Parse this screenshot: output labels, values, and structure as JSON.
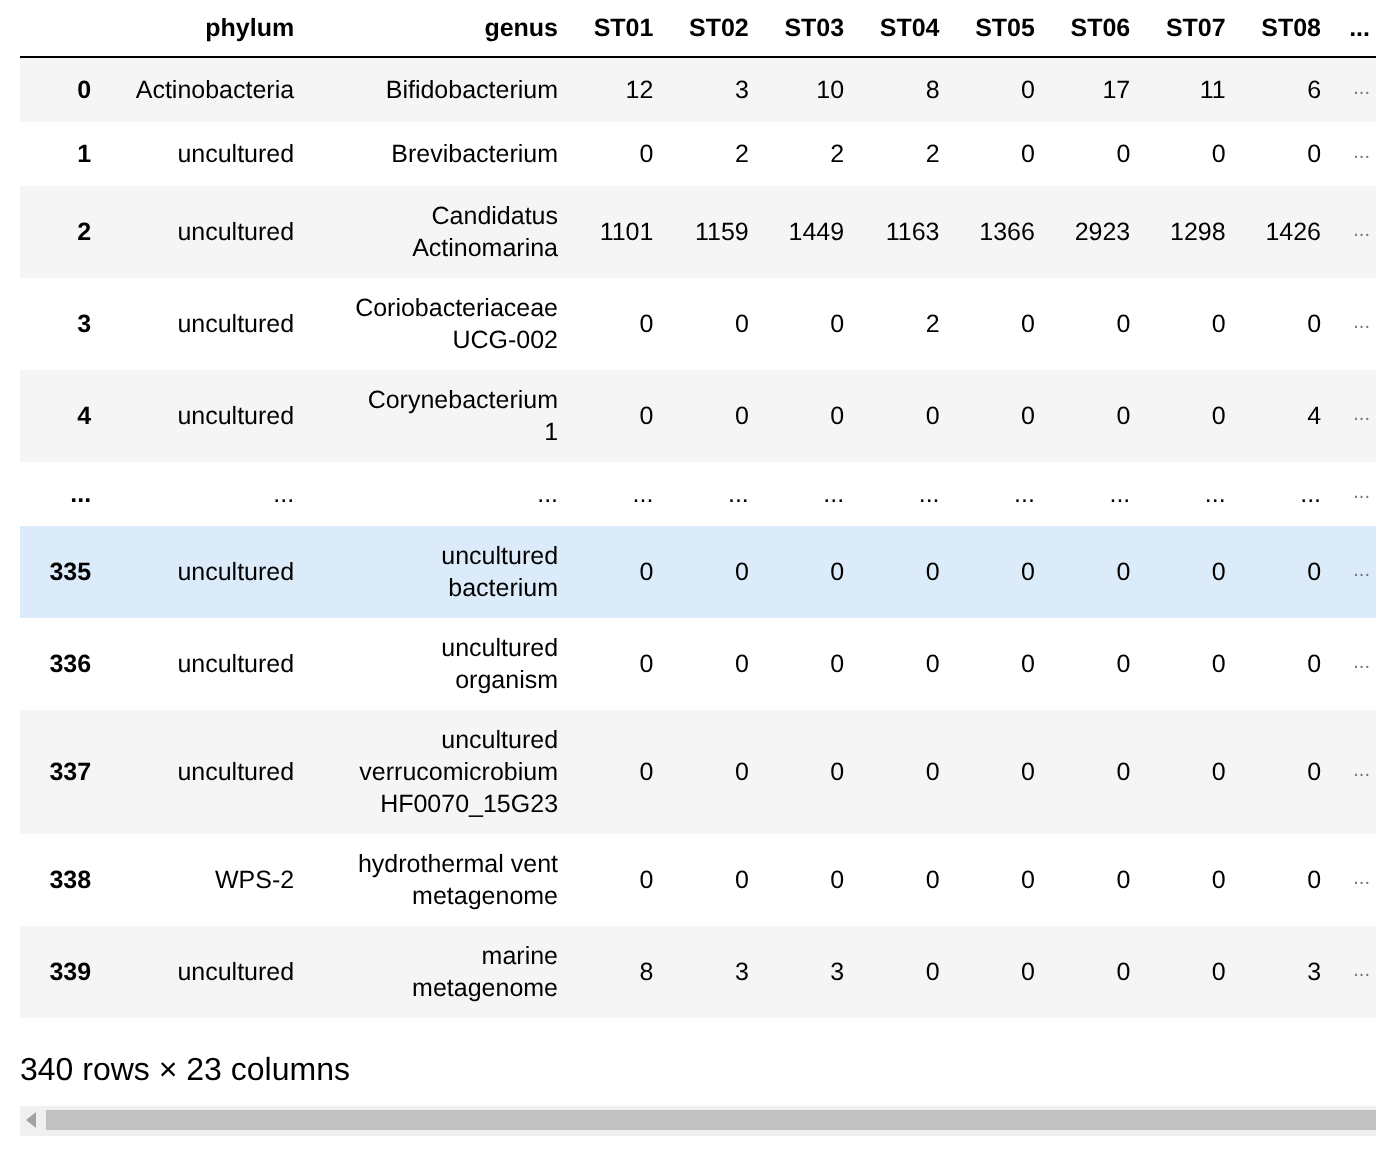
{
  "table": {
    "columns": [
      "",
      "phylum",
      "genus",
      "ST01",
      "ST02",
      "ST03",
      "ST04",
      "ST05",
      "ST06",
      "ST07",
      "ST08",
      "..."
    ],
    "rows": [
      {
        "cells": [
          "0",
          "Actinobacteria",
          "Bifidobacterium",
          "12",
          "3",
          "10",
          "8",
          "0",
          "17",
          "11",
          "6",
          "..."
        ],
        "selected": false
      },
      {
        "cells": [
          "1",
          "uncultured",
          "Brevibacterium",
          "0",
          "2",
          "2",
          "2",
          "0",
          "0",
          "0",
          "0",
          "..."
        ],
        "selected": false
      },
      {
        "cells": [
          "2",
          "uncultured",
          "Candidatus\nActinomarina",
          "1101",
          "1159",
          "1449",
          "1163",
          "1366",
          "2923",
          "1298",
          "1426",
          "..."
        ],
        "selected": false
      },
      {
        "cells": [
          "3",
          "uncultured",
          "Coriobacteriaceae\nUCG-002",
          "0",
          "0",
          "0",
          "2",
          "0",
          "0",
          "0",
          "0",
          "..."
        ],
        "selected": false
      },
      {
        "cells": [
          "4",
          "uncultured",
          "Corynebacterium\n1",
          "0",
          "0",
          "0",
          "0",
          "0",
          "0",
          "0",
          "4",
          "..."
        ],
        "selected": false
      },
      {
        "cells": [
          "...",
          "...",
          "...",
          "...",
          "...",
          "...",
          "...",
          "...",
          "...",
          "...",
          "...",
          "..."
        ],
        "selected": false
      },
      {
        "cells": [
          "335",
          "uncultured",
          "uncultured\nbacterium",
          "0",
          "0",
          "0",
          "0",
          "0",
          "0",
          "0",
          "0",
          "..."
        ],
        "selected": true
      },
      {
        "cells": [
          "336",
          "uncultured",
          "uncultured\norganism",
          "0",
          "0",
          "0",
          "0",
          "0",
          "0",
          "0",
          "0",
          "..."
        ],
        "selected": false
      },
      {
        "cells": [
          "337",
          "uncultured",
          "uncultured\nverrucomicrobium\nHF0070_15G23",
          "0",
          "0",
          "0",
          "0",
          "0",
          "0",
          "0",
          "0",
          "..."
        ],
        "selected": false
      },
      {
        "cells": [
          "338",
          "WPS-2",
          "hydrothermal vent\nmetagenome",
          "0",
          "0",
          "0",
          "0",
          "0",
          "0",
          "0",
          "0",
          "..."
        ],
        "selected": false
      },
      {
        "cells": [
          "339",
          "uncultured",
          "marine\nmetagenome",
          "8",
          "3",
          "3",
          "0",
          "0",
          "0",
          "0",
          "3",
          "..."
        ],
        "selected": false
      }
    ]
  },
  "summary": "340 rows × 23 columns"
}
